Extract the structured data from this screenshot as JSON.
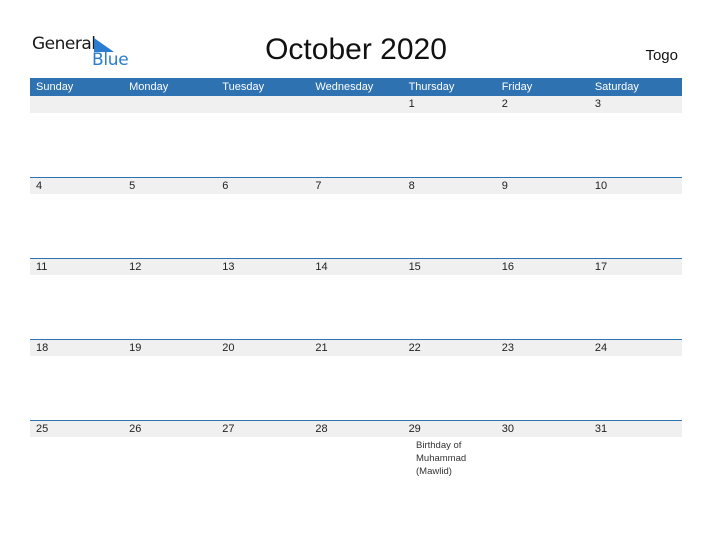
{
  "brand": {
    "line1": "General",
    "line2": "Blue"
  },
  "title": "October 2020",
  "country": "Togo",
  "colors": {
    "header": "#2e72b2",
    "rowShade": "#f0f0f0",
    "brandBlue": "#2b7bd1"
  },
  "weekdays": [
    "Sunday",
    "Monday",
    "Tuesday",
    "Wednesday",
    "Thursday",
    "Friday",
    "Saturday"
  ],
  "weeks": [
    {
      "days": [
        "",
        "",
        "",
        "",
        "1",
        "2",
        "3"
      ],
      "events": [
        "",
        "",
        "",
        "",
        "",
        "",
        ""
      ]
    },
    {
      "days": [
        "4",
        "5",
        "6",
        "7",
        "8",
        "9",
        "10"
      ],
      "events": [
        "",
        "",
        "",
        "",
        "",
        "",
        ""
      ]
    },
    {
      "days": [
        "11",
        "12",
        "13",
        "14",
        "15",
        "16",
        "17"
      ],
      "events": [
        "",
        "",
        "",
        "",
        "",
        "",
        ""
      ]
    },
    {
      "days": [
        "18",
        "19",
        "20",
        "21",
        "22",
        "23",
        "24"
      ],
      "events": [
        "",
        "",
        "",
        "",
        "",
        "",
        ""
      ]
    },
    {
      "days": [
        "25",
        "26",
        "27",
        "28",
        "29",
        "30",
        "31"
      ],
      "events": [
        "",
        "",
        "",
        "",
        "",
        "Birthday of Muhammad (Mawlid)",
        ""
      ]
    }
  ]
}
